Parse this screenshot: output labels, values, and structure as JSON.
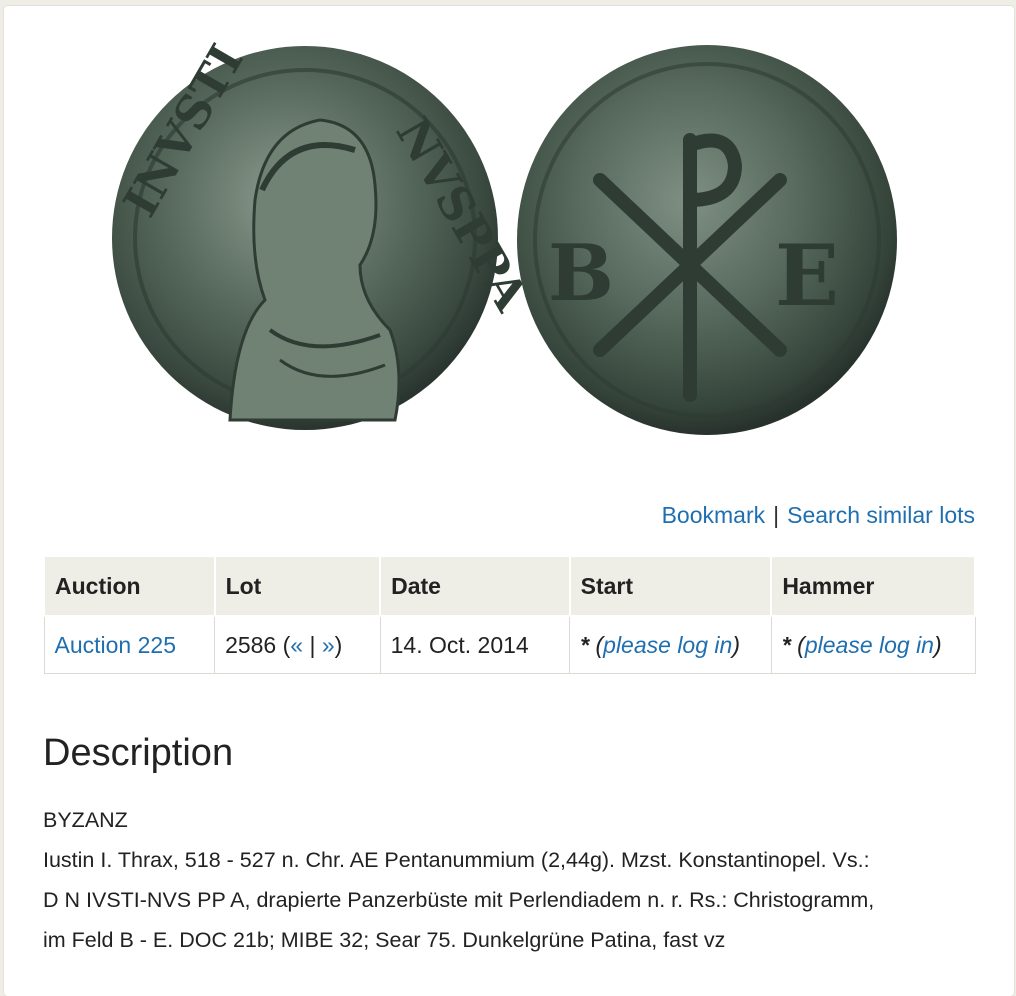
{
  "images": {
    "obverse_alt": "Coin obverse",
    "reverse_alt": "Coin reverse",
    "obverse_legend_left": "INVSTI",
    "obverse_legend_right": "NVSPPA",
    "reverse_left_letter": "B",
    "reverse_right_letter": "E",
    "patina_color": "#4f6358"
  },
  "actions": {
    "bookmark": "Bookmark",
    "separator": "|",
    "search_similar": "Search similar lots"
  },
  "table": {
    "headers": [
      "Auction",
      "Lot",
      "Date",
      "Start",
      "Hammer"
    ],
    "row": {
      "auction": "Auction 225",
      "lot_number": "2586",
      "lot_prev": "«",
      "lot_sep": "|",
      "lot_next": "»",
      "date": "14. Oct. 2014",
      "start_star": "*",
      "start_login": "please log in",
      "hammer_star": "*",
      "hammer_login": "please log in"
    }
  },
  "description": {
    "title": "Description",
    "line1": "BYZANZ",
    "line2": "Iustin I. Thrax, 518 - 527 n. Chr. AE Pentanummium (2,44g). Mzst. Konstantinopel. Vs.:",
    "line3": "D N IVSTI-NVS PP A, drapierte Panzerbüste mit Perlendiadem n. r. Rs.: Christogramm,",
    "line4": "im Feld B - E. DOC 21b; MIBE 32; Sear 75. Dunkelgrüne Patina, fast vz"
  },
  "colors": {
    "link": "#1f6fb0",
    "header_bg": "#efeee6"
  }
}
